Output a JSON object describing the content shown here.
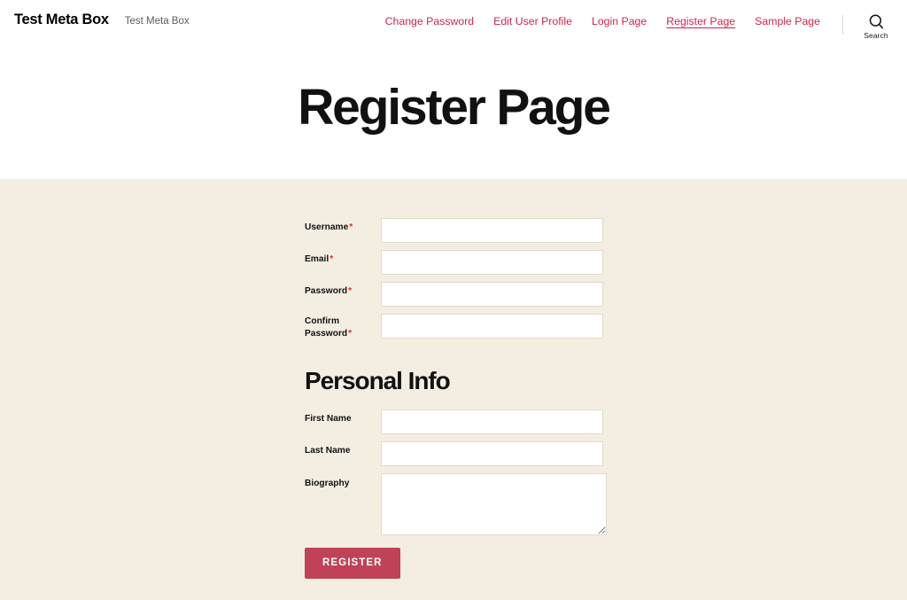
{
  "header": {
    "site_title": "Test Meta Box",
    "tagline": "Test Meta Box",
    "nav": [
      {
        "label": "Change Password",
        "current": false
      },
      {
        "label": "Edit User Profile",
        "current": false
      },
      {
        "label": "Login Page",
        "current": false
      },
      {
        "label": "Register Page",
        "current": true
      },
      {
        "label": "Sample Page",
        "current": false
      }
    ],
    "search": {
      "icon": "search-icon",
      "label": "Search"
    },
    "link_color": "#c9284a"
  },
  "hero": {
    "page_title": "Register Page"
  },
  "content": {
    "background_color": "#f4eee2",
    "required_marker": "*",
    "account_fields": [
      {
        "label": "Username",
        "required": true,
        "value": "",
        "placeholder": "",
        "type": "text",
        "name": "username-field"
      },
      {
        "label": "Email",
        "required": true,
        "value": "",
        "placeholder": "",
        "type": "text",
        "name": "email-field"
      },
      {
        "label": "Password",
        "required": true,
        "value": "",
        "placeholder": "",
        "type": "password",
        "name": "password-field"
      },
      {
        "label": "Confirm Password",
        "required": true,
        "value": "",
        "placeholder": "",
        "type": "password",
        "name": "confirm-password-field"
      }
    ],
    "personal_info": {
      "heading": "Personal Info",
      "fields": [
        {
          "label": "First Name",
          "required": false,
          "value": "",
          "placeholder": "",
          "type": "text",
          "name": "first-name-field"
        },
        {
          "label": "Last Name",
          "required": false,
          "value": "",
          "placeholder": "",
          "type": "text",
          "name": "last-name-field"
        }
      ],
      "biography": {
        "label": "Biography",
        "required": false,
        "value": "",
        "placeholder": "",
        "name": "biography-field"
      }
    },
    "submit": {
      "label": "Register",
      "color": "#bf4257"
    }
  }
}
